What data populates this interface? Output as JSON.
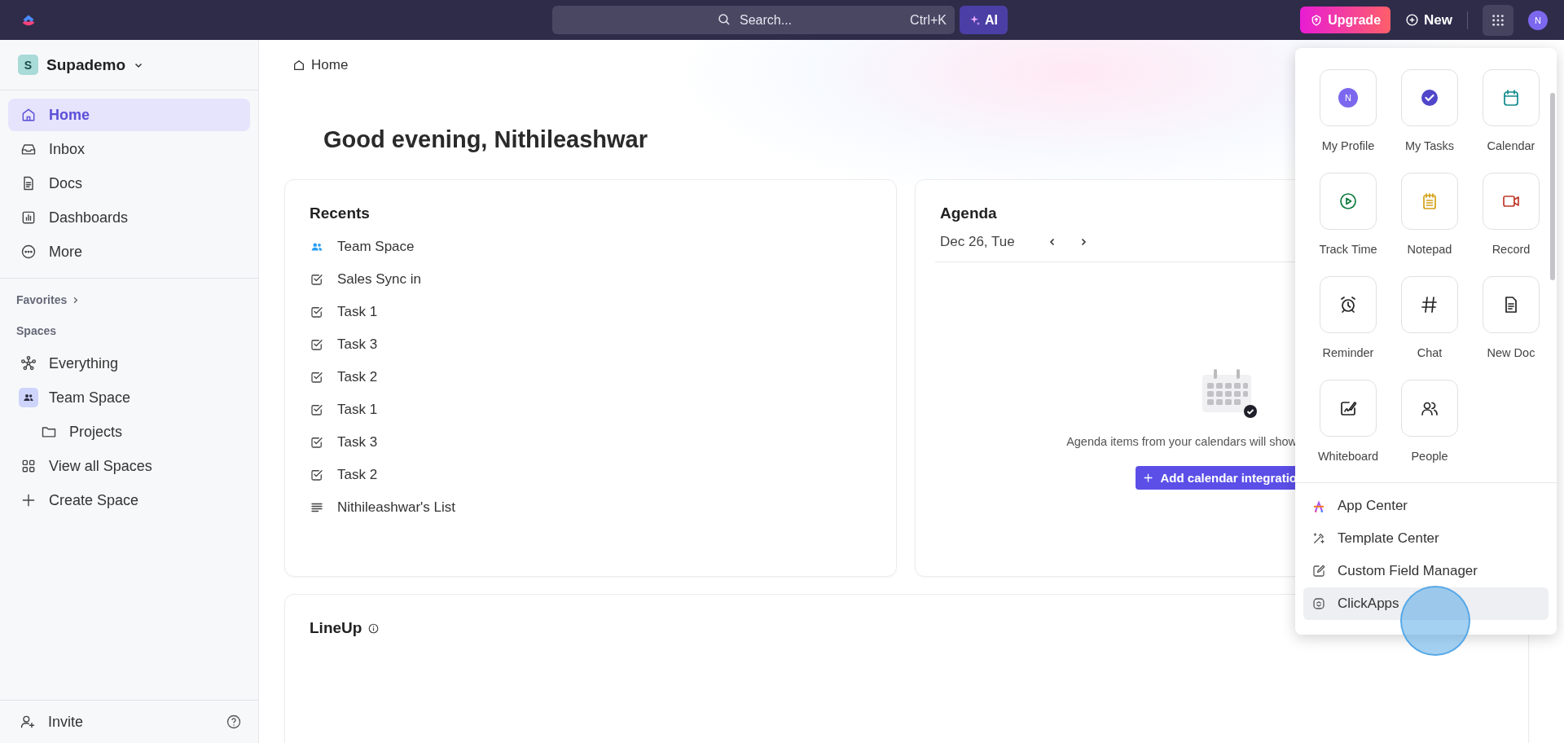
{
  "topbar": {
    "search": {
      "placeholder": "Search...",
      "shortcut": "Ctrl+K"
    },
    "ai_button": "AI",
    "upgrade_button": "Upgrade",
    "new_button": "New",
    "avatar": "N"
  },
  "sidebar": {
    "workspace": {
      "initial": "S",
      "name": "Supademo"
    },
    "nav": [
      {
        "label": "Home",
        "selected": true
      },
      {
        "label": "Inbox",
        "selected": false
      },
      {
        "label": "Docs",
        "selected": false
      },
      {
        "label": "Dashboards",
        "selected": false
      },
      {
        "label": "More",
        "selected": false
      }
    ],
    "favorites": "Favorites",
    "spaces_heading": "Spaces",
    "spaces": [
      {
        "label": "Everything"
      },
      {
        "label": "Team Space",
        "children": [
          {
            "label": "Projects"
          }
        ]
      },
      {
        "label": "View all Spaces"
      },
      {
        "label": "Create Space"
      }
    ],
    "invite": "Invite"
  },
  "breadcrumb": "Home",
  "greeting": "Good evening, Nithileashwar",
  "recents": {
    "title": "Recents",
    "items": [
      {
        "label": "Team Space",
        "kind": "space"
      },
      {
        "label": "Sales Sync in",
        "kind": "task"
      },
      {
        "label": "Task 1",
        "kind": "task"
      },
      {
        "label": "Task 3",
        "kind": "task"
      },
      {
        "label": "Task 2",
        "kind": "task"
      },
      {
        "label": "Task 1",
        "kind": "task"
      },
      {
        "label": "Task 3",
        "kind": "task"
      },
      {
        "label": "Task 2",
        "kind": "task"
      },
      {
        "label": "Nithileashwar's List",
        "kind": "list"
      }
    ]
  },
  "agenda": {
    "title": "Agenda",
    "date": "Dec 26, Tue",
    "empty_text": "Agenda items from your calendars will show",
    "add_button": "Add calendar integratio"
  },
  "lineup": {
    "title": "LineUp"
  },
  "apps_menu": {
    "tiles": [
      {
        "label": "My Profile",
        "avatar": "N"
      },
      {
        "label": "My Tasks"
      },
      {
        "label": "Calendar"
      },
      {
        "label": "Track Time"
      },
      {
        "label": "Notepad"
      },
      {
        "label": "Record"
      },
      {
        "label": "Reminder"
      },
      {
        "label": "Chat"
      },
      {
        "label": "New Doc"
      },
      {
        "label": "Whiteboard"
      },
      {
        "label": "People"
      }
    ],
    "links": [
      {
        "label": "App Center",
        "selected": false
      },
      {
        "label": "Template Center",
        "selected": false
      },
      {
        "label": "Custom Field Manager",
        "selected": false
      },
      {
        "label": "ClickApps",
        "selected": true
      }
    ]
  }
}
